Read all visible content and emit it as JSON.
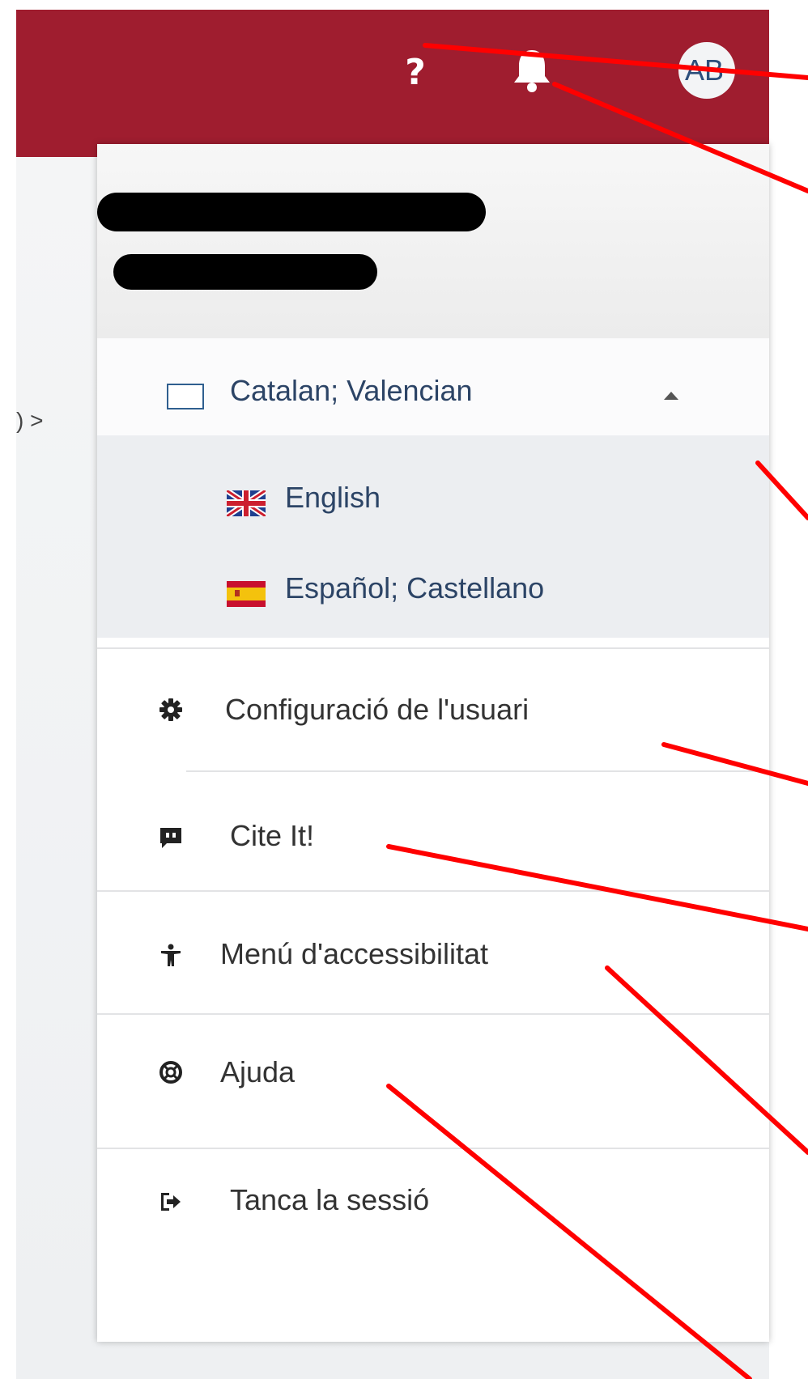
{
  "header": {
    "avatar_initials": "AB",
    "help_label": "?",
    "brand_color": "#9f1d2f"
  },
  "page": {
    "breadcrumb_fragment": ") >"
  },
  "menu": {
    "language": {
      "current": "Catalan; Valencian",
      "options": [
        {
          "label": "English",
          "flag": "uk-flag-icon"
        },
        {
          "label": "Español; Castellano",
          "flag": "es-flag-icon"
        }
      ]
    },
    "items": [
      {
        "label": "Configuració de l'usuari",
        "icon": "gear-icon"
      },
      {
        "label": "Cite It!",
        "icon": "quote-icon"
      },
      {
        "label": "Menú d'accessibilitat",
        "icon": "accessibility-icon"
      },
      {
        "label": "Ajuda",
        "icon": "lifebuoy-icon"
      },
      {
        "label": "Tanca la sessió",
        "icon": "logout-icon"
      }
    ]
  },
  "annotation_color": "#ff0000"
}
